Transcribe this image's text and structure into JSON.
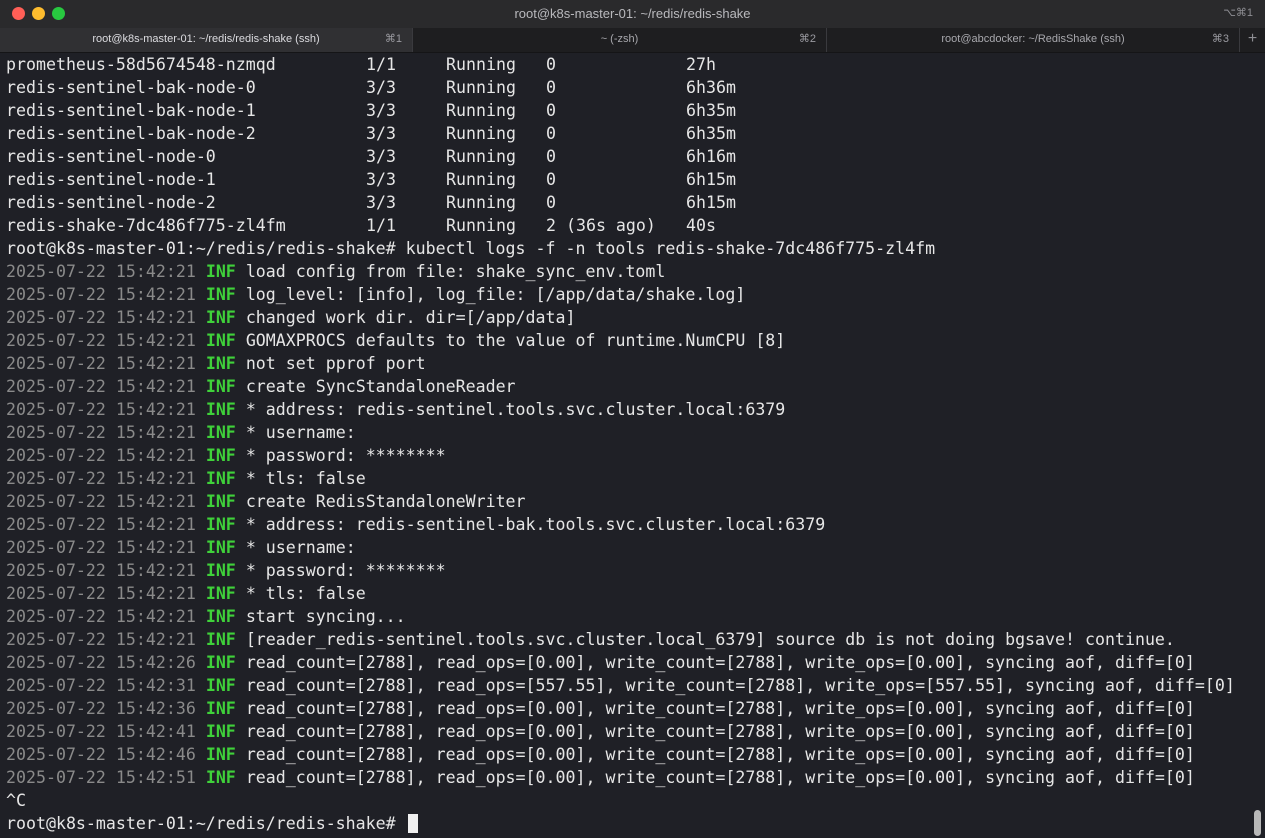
{
  "window": {
    "title": "root@k8s-master-01: ~/redis/redis-shake",
    "shortcut": "⌥⌘1"
  },
  "tabs": [
    {
      "label": "root@k8s-master-01: ~/redis/redis-shake (ssh)",
      "key": "⌘1",
      "active": true
    },
    {
      "label": "~ (-zsh)",
      "key": "⌘2",
      "active": false
    },
    {
      "label": "root@abcdocker: ~/RedisShake (ssh)",
      "key": "⌘3",
      "active": false
    }
  ],
  "tab_add_label": "+",
  "pods": [
    {
      "name": "prometheus-58d5674548-nzmqd",
      "ready": "1/1",
      "status": "Running",
      "restarts": "0",
      "age": "27h"
    },
    {
      "name": "redis-sentinel-bak-node-0",
      "ready": "3/3",
      "status": "Running",
      "restarts": "0",
      "age": "6h36m"
    },
    {
      "name": "redis-sentinel-bak-node-1",
      "ready": "3/3",
      "status": "Running",
      "restarts": "0",
      "age": "6h35m"
    },
    {
      "name": "redis-sentinel-bak-node-2",
      "ready": "3/3",
      "status": "Running",
      "restarts": "0",
      "age": "6h35m"
    },
    {
      "name": "redis-sentinel-node-0",
      "ready": "3/3",
      "status": "Running",
      "restarts": "0",
      "age": "6h16m"
    },
    {
      "name": "redis-sentinel-node-1",
      "ready": "3/3",
      "status": "Running",
      "restarts": "0",
      "age": "6h15m"
    },
    {
      "name": "redis-sentinel-node-2",
      "ready": "3/3",
      "status": "Running",
      "restarts": "0",
      "age": "6h15m"
    },
    {
      "name": "redis-shake-7dc486f775-zl4fm",
      "ready": "1/1",
      "status": "Running",
      "restarts": "2 (36s ago)",
      "age": "40s"
    }
  ],
  "command_line": "root@k8s-master-01:~/redis/redis-shake# kubectl logs -f -n tools redis-shake-7dc486f775-zl4fm",
  "logs": [
    {
      "ts": "2025-07-22 15:42:21",
      "level": "INF",
      "msg": "load config from file: shake_sync_env.toml"
    },
    {
      "ts": "2025-07-22 15:42:21",
      "level": "INF",
      "msg": "log_level: [info], log_file: [/app/data/shake.log]"
    },
    {
      "ts": "2025-07-22 15:42:21",
      "level": "INF",
      "msg": "changed work dir. dir=[/app/data]"
    },
    {
      "ts": "2025-07-22 15:42:21",
      "level": "INF",
      "msg": "GOMAXPROCS defaults to the value of runtime.NumCPU [8]"
    },
    {
      "ts": "2025-07-22 15:42:21",
      "level": "INF",
      "msg": "not set pprof port"
    },
    {
      "ts": "2025-07-22 15:42:21",
      "level": "INF",
      "msg": "create SyncStandaloneReader"
    },
    {
      "ts": "2025-07-22 15:42:21",
      "level": "INF",
      "msg": "* address: redis-sentinel.tools.svc.cluster.local:6379"
    },
    {
      "ts": "2025-07-22 15:42:21",
      "level": "INF",
      "msg": "* username:"
    },
    {
      "ts": "2025-07-22 15:42:21",
      "level": "INF",
      "msg": "* password: ********"
    },
    {
      "ts": "2025-07-22 15:42:21",
      "level": "INF",
      "msg": "* tls: false"
    },
    {
      "ts": "2025-07-22 15:42:21",
      "level": "INF",
      "msg": "create RedisStandaloneWriter"
    },
    {
      "ts": "2025-07-22 15:42:21",
      "level": "INF",
      "msg": "* address: redis-sentinel-bak.tools.svc.cluster.local:6379"
    },
    {
      "ts": "2025-07-22 15:42:21",
      "level": "INF",
      "msg": "* username:"
    },
    {
      "ts": "2025-07-22 15:42:21",
      "level": "INF",
      "msg": "* password: ********"
    },
    {
      "ts": "2025-07-22 15:42:21",
      "level": "INF",
      "msg": "* tls: false"
    },
    {
      "ts": "2025-07-22 15:42:21",
      "level": "INF",
      "msg": "start syncing..."
    },
    {
      "ts": "2025-07-22 15:42:21",
      "level": "INF",
      "msg": "[reader_redis-sentinel.tools.svc.cluster.local_6379] source db is not doing bgsave! continue."
    },
    {
      "ts": "2025-07-22 15:42:26",
      "level": "INF",
      "msg": "read_count=[2788], read_ops=[0.00], write_count=[2788], write_ops=[0.00], syncing aof, diff=[0]"
    },
    {
      "ts": "2025-07-22 15:42:31",
      "level": "INF",
      "msg": "read_count=[2788], read_ops=[557.55], write_count=[2788], write_ops=[557.55], syncing aof, diff=[0]"
    },
    {
      "ts": "2025-07-22 15:42:36",
      "level": "INF",
      "msg": "read_count=[2788], read_ops=[0.00], write_count=[2788], write_ops=[0.00], syncing aof, diff=[0]"
    },
    {
      "ts": "2025-07-22 15:42:41",
      "level": "INF",
      "msg": "read_count=[2788], read_ops=[0.00], write_count=[2788], write_ops=[0.00], syncing aof, diff=[0]"
    },
    {
      "ts": "2025-07-22 15:42:46",
      "level": "INF",
      "msg": "read_count=[2788], read_ops=[0.00], write_count=[2788], write_ops=[0.00], syncing aof, diff=[0]"
    },
    {
      "ts": "2025-07-22 15:42:51",
      "level": "INF",
      "msg": "read_count=[2788], read_ops=[0.00], write_count=[2788], write_ops=[0.00], syncing aof, diff=[0]"
    }
  ],
  "interrupt_line": "^C",
  "prompt": "root@k8s-master-01:~/redis/redis-shake#",
  "colors": {
    "log_level": "#3fd13a",
    "timestamp": "#8a8a8a",
    "text": "#e6e6e6",
    "background": "#1f2026"
  }
}
